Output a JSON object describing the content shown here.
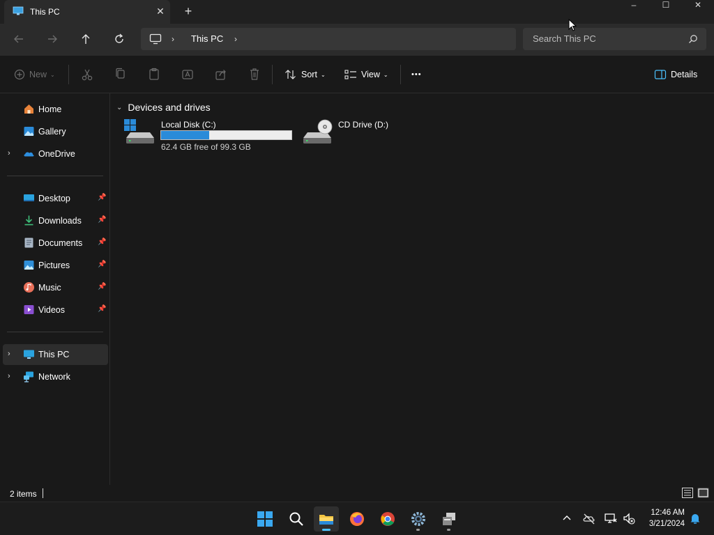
{
  "window": {
    "tab_title": "This PC",
    "minimize_glyph": "–",
    "maximize_glyph": "☐",
    "close_glyph": "✕",
    "tab_close_glyph": "✕",
    "new_tab_glyph": "+"
  },
  "address": {
    "breadcrumb": "This PC",
    "chevron": "›"
  },
  "search": {
    "placeholder": "Search This PC"
  },
  "commands": {
    "new_label": "New",
    "sort_label": "Sort",
    "view_label": "View",
    "more_glyph": "•••",
    "details_label": "Details",
    "caret": "⌄"
  },
  "sidebar": {
    "pin_glyph": "📌",
    "expand_glyph": "›",
    "items": [
      {
        "label": "Home",
        "icon": "home-icon"
      },
      {
        "label": "Gallery",
        "icon": "gallery-icon"
      },
      {
        "label": "OneDrive",
        "icon": "onedrive-icon"
      },
      {
        "label": "Desktop",
        "icon": "desktop-icon",
        "pinned": true
      },
      {
        "label": "Downloads",
        "icon": "downloads-icon",
        "pinned": true
      },
      {
        "label": "Documents",
        "icon": "documents-icon",
        "pinned": true
      },
      {
        "label": "Pictures",
        "icon": "pictures-icon",
        "pinned": true
      },
      {
        "label": "Music",
        "icon": "music-icon",
        "pinned": true
      },
      {
        "label": "Videos",
        "icon": "videos-icon",
        "pinned": true
      },
      {
        "label": "This PC",
        "icon": "this-pc-icon",
        "selected": true
      },
      {
        "label": "Network",
        "icon": "network-icon"
      }
    ]
  },
  "content": {
    "group_header": "Devices and drives",
    "group_chevron": "⌄",
    "drives": [
      {
        "name": "Local Disk (C:)",
        "free_text": "62.4 GB free of 99.3 GB",
        "used_fraction": 0.37,
        "icon": "hard-drive-icon"
      },
      {
        "name": "CD Drive (D:)",
        "icon": "cd-drive-icon"
      }
    ]
  },
  "status": {
    "item_count": "2 items"
  },
  "taskbar": {
    "apps": [
      "start-icon",
      "search-icon",
      "file-explorer-icon",
      "firefox-icon",
      "chrome-icon",
      "settings-icon",
      "app-icon"
    ],
    "clock_time": "12:46 AM",
    "clock_date": "3/21/2024"
  },
  "colors": {
    "accent": "#4cc2ff",
    "drive_bar": "#2a8bd9",
    "background": "#191919"
  }
}
